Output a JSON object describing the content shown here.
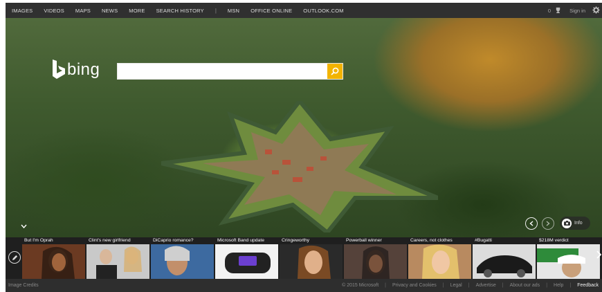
{
  "nav": {
    "items": [
      "IMAGES",
      "VIDEOS",
      "MAPS",
      "NEWS",
      "MORE",
      "SEARCH HISTORY"
    ],
    "separator": "|",
    "links": [
      "MSN",
      "OFFICE ONLINE",
      "OUTLOOK.COM"
    ]
  },
  "account": {
    "rewards_count": "0",
    "sign_in": "Sign in"
  },
  "brand": {
    "name": "bing"
  },
  "search": {
    "value": "",
    "placeholder": ""
  },
  "hero": {
    "info_label": "Info"
  },
  "news": [
    {
      "caption": "But I'm Oprah"
    },
    {
      "caption": "Clint's new girlfriend"
    },
    {
      "caption": "DiCaprio romance?"
    },
    {
      "caption": "Microsoft Band update"
    },
    {
      "caption": "Cringeworthy"
    },
    {
      "caption": "Powerball winner"
    },
    {
      "caption": "Careers, not clothes"
    },
    {
      "caption": "#Bugatti"
    },
    {
      "caption": "$218M verdict"
    }
  ],
  "footer": {
    "image_credits": "Image Credits",
    "copyright": "© 2015 Microsoft",
    "links": [
      "Privacy and Cookies",
      "Legal",
      "Advertise",
      "About our ads",
      "Help"
    ],
    "feedback": "Feedback"
  }
}
